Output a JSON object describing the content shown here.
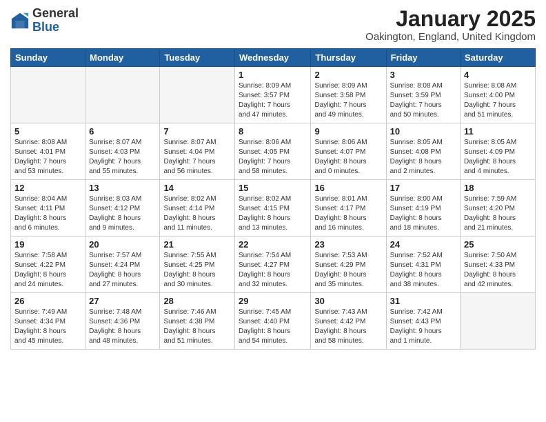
{
  "header": {
    "logo_general": "General",
    "logo_blue": "Blue",
    "month_title": "January 2025",
    "location": "Oakington, England, United Kingdom"
  },
  "weekdays": [
    "Sunday",
    "Monday",
    "Tuesday",
    "Wednesday",
    "Thursday",
    "Friday",
    "Saturday"
  ],
  "weeks": [
    [
      {
        "day": "",
        "info": ""
      },
      {
        "day": "",
        "info": ""
      },
      {
        "day": "",
        "info": ""
      },
      {
        "day": "1",
        "info": "Sunrise: 8:09 AM\nSunset: 3:57 PM\nDaylight: 7 hours\nand 47 minutes."
      },
      {
        "day": "2",
        "info": "Sunrise: 8:09 AM\nSunset: 3:58 PM\nDaylight: 7 hours\nand 49 minutes."
      },
      {
        "day": "3",
        "info": "Sunrise: 8:08 AM\nSunset: 3:59 PM\nDaylight: 7 hours\nand 50 minutes."
      },
      {
        "day": "4",
        "info": "Sunrise: 8:08 AM\nSunset: 4:00 PM\nDaylight: 7 hours\nand 51 minutes."
      }
    ],
    [
      {
        "day": "5",
        "info": "Sunrise: 8:08 AM\nSunset: 4:01 PM\nDaylight: 7 hours\nand 53 minutes."
      },
      {
        "day": "6",
        "info": "Sunrise: 8:07 AM\nSunset: 4:03 PM\nDaylight: 7 hours\nand 55 minutes."
      },
      {
        "day": "7",
        "info": "Sunrise: 8:07 AM\nSunset: 4:04 PM\nDaylight: 7 hours\nand 56 minutes."
      },
      {
        "day": "8",
        "info": "Sunrise: 8:06 AM\nSunset: 4:05 PM\nDaylight: 7 hours\nand 58 minutes."
      },
      {
        "day": "9",
        "info": "Sunrise: 8:06 AM\nSunset: 4:07 PM\nDaylight: 8 hours\nand 0 minutes."
      },
      {
        "day": "10",
        "info": "Sunrise: 8:05 AM\nSunset: 4:08 PM\nDaylight: 8 hours\nand 2 minutes."
      },
      {
        "day": "11",
        "info": "Sunrise: 8:05 AM\nSunset: 4:09 PM\nDaylight: 8 hours\nand 4 minutes."
      }
    ],
    [
      {
        "day": "12",
        "info": "Sunrise: 8:04 AM\nSunset: 4:11 PM\nDaylight: 8 hours\nand 6 minutes."
      },
      {
        "day": "13",
        "info": "Sunrise: 8:03 AM\nSunset: 4:12 PM\nDaylight: 8 hours\nand 9 minutes."
      },
      {
        "day": "14",
        "info": "Sunrise: 8:02 AM\nSunset: 4:14 PM\nDaylight: 8 hours\nand 11 minutes."
      },
      {
        "day": "15",
        "info": "Sunrise: 8:02 AM\nSunset: 4:15 PM\nDaylight: 8 hours\nand 13 minutes."
      },
      {
        "day": "16",
        "info": "Sunrise: 8:01 AM\nSunset: 4:17 PM\nDaylight: 8 hours\nand 16 minutes."
      },
      {
        "day": "17",
        "info": "Sunrise: 8:00 AM\nSunset: 4:19 PM\nDaylight: 8 hours\nand 18 minutes."
      },
      {
        "day": "18",
        "info": "Sunrise: 7:59 AM\nSunset: 4:20 PM\nDaylight: 8 hours\nand 21 minutes."
      }
    ],
    [
      {
        "day": "19",
        "info": "Sunrise: 7:58 AM\nSunset: 4:22 PM\nDaylight: 8 hours\nand 24 minutes."
      },
      {
        "day": "20",
        "info": "Sunrise: 7:57 AM\nSunset: 4:24 PM\nDaylight: 8 hours\nand 27 minutes."
      },
      {
        "day": "21",
        "info": "Sunrise: 7:55 AM\nSunset: 4:25 PM\nDaylight: 8 hours\nand 30 minutes."
      },
      {
        "day": "22",
        "info": "Sunrise: 7:54 AM\nSunset: 4:27 PM\nDaylight: 8 hours\nand 32 minutes."
      },
      {
        "day": "23",
        "info": "Sunrise: 7:53 AM\nSunset: 4:29 PM\nDaylight: 8 hours\nand 35 minutes."
      },
      {
        "day": "24",
        "info": "Sunrise: 7:52 AM\nSunset: 4:31 PM\nDaylight: 8 hours\nand 38 minutes."
      },
      {
        "day": "25",
        "info": "Sunrise: 7:50 AM\nSunset: 4:33 PM\nDaylight: 8 hours\nand 42 minutes."
      }
    ],
    [
      {
        "day": "26",
        "info": "Sunrise: 7:49 AM\nSunset: 4:34 PM\nDaylight: 8 hours\nand 45 minutes."
      },
      {
        "day": "27",
        "info": "Sunrise: 7:48 AM\nSunset: 4:36 PM\nDaylight: 8 hours\nand 48 minutes."
      },
      {
        "day": "28",
        "info": "Sunrise: 7:46 AM\nSunset: 4:38 PM\nDaylight: 8 hours\nand 51 minutes."
      },
      {
        "day": "29",
        "info": "Sunrise: 7:45 AM\nSunset: 4:40 PM\nDaylight: 8 hours\nand 54 minutes."
      },
      {
        "day": "30",
        "info": "Sunrise: 7:43 AM\nSunset: 4:42 PM\nDaylight: 8 hours\nand 58 minutes."
      },
      {
        "day": "31",
        "info": "Sunrise: 7:42 AM\nSunset: 4:43 PM\nDaylight: 9 hours\nand 1 minute."
      },
      {
        "day": "",
        "info": ""
      }
    ]
  ]
}
